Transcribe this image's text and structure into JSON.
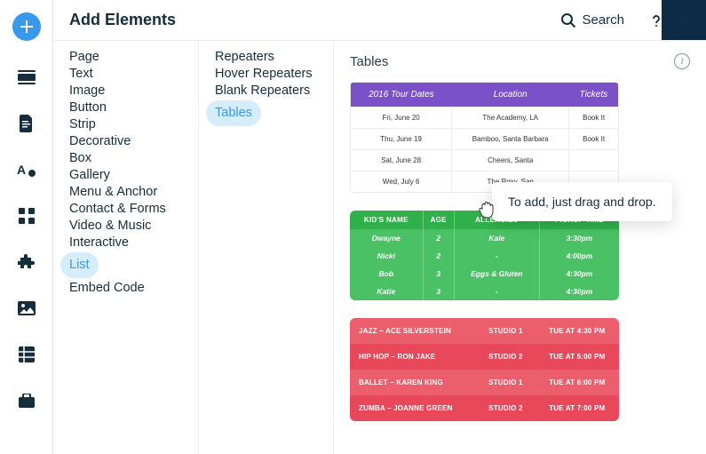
{
  "header": {
    "title": "Add Elements",
    "search_label": "Search"
  },
  "categories": [
    "Page",
    "Text",
    "Image",
    "Button",
    "Strip",
    "Decorative",
    "Box",
    "Gallery",
    "Menu & Anchor",
    "Contact & Forms",
    "Video & Music",
    "Interactive",
    "List",
    "Embed Code"
  ],
  "categories_active_index": 12,
  "subcategories": [
    "Repeaters",
    "Hover Repeaters",
    "Blank Repeaters",
    "Tables"
  ],
  "subcategories_active_index": 3,
  "section_title": "Tables",
  "tooltip": "To add, just drag and drop.",
  "table_purple": {
    "headers": [
      "2016 Tour Dates",
      "Location",
      "Tickets"
    ],
    "rows": [
      [
        "Fri, June 20",
        "The Academy, LA",
        "Book It"
      ],
      [
        "Thu, June 19",
        "Bamboo, Santa Barbara",
        "Book It"
      ],
      [
        "Sat, June 28",
        "Cheers, Santa",
        ""
      ],
      [
        "Wed, July 6",
        "The Roxy, San",
        ""
      ]
    ]
  },
  "table_green": {
    "headers": [
      "KID'S NAME",
      "AGE",
      "ALLERGIES",
      "PICKUP TIME"
    ],
    "rows": [
      [
        "Dwayne",
        "2",
        "Kale",
        "3:30pm"
      ],
      [
        "Nicki",
        "2",
        "-",
        "4:00pm"
      ],
      [
        "Bob",
        "3",
        "Eggs & Gluten",
        "4:30pm"
      ],
      [
        "Katie",
        "3",
        "-",
        "4:30pm"
      ]
    ]
  },
  "table_red": {
    "rows": [
      [
        "JAZZ – ACE SILVERSTEIN",
        "STUDIO 1",
        "TUE AT 4:30 PM"
      ],
      [
        "HIP HOP – RON JAKE",
        "STUDIO 2",
        "TUE AT 5:00 PM"
      ],
      [
        "BALLET – KAREN KING",
        "STUDIO 1",
        "TUE AT 6:00 PM"
      ],
      [
        "ZUMBA – JOANNE GREEN",
        "STUDIO 2",
        "TUE AT 7:00 PM"
      ]
    ]
  }
}
